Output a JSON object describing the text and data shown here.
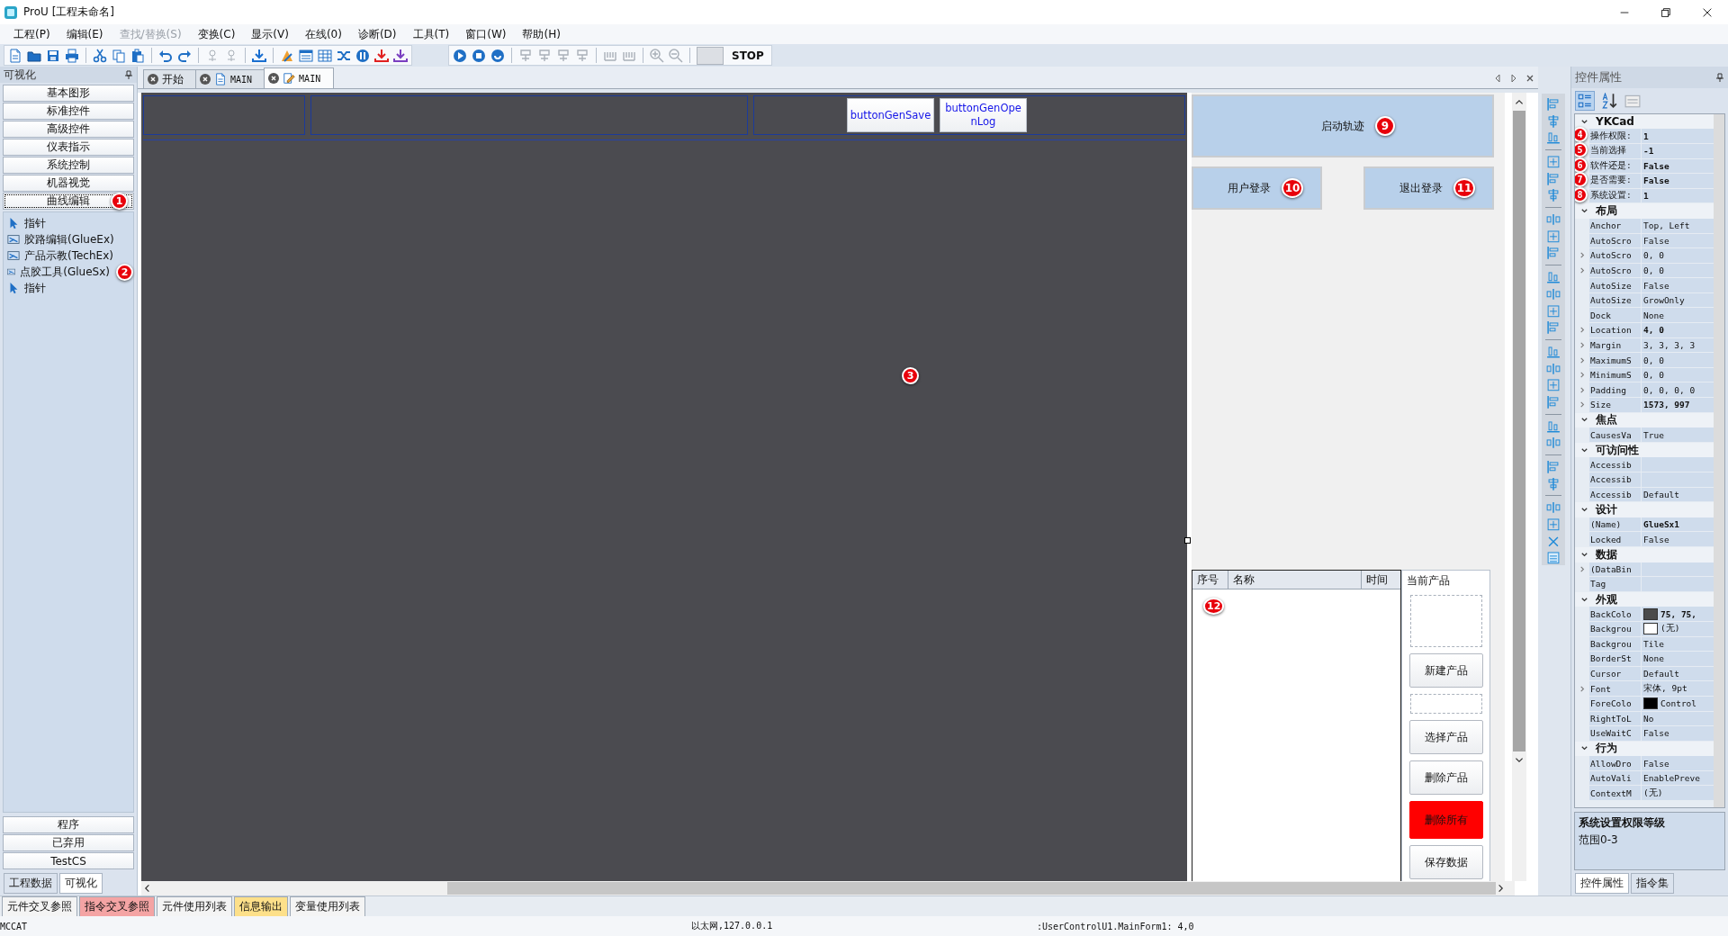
{
  "window": {
    "title": "ProU [工程未命名]"
  },
  "menu": [
    {
      "label": "工程(P)",
      "disabled": false
    },
    {
      "label": "编辑(E)",
      "disabled": false
    },
    {
      "label": "查找/替换(S)",
      "disabled": true
    },
    {
      "label": "变换(C)",
      "disabled": false
    },
    {
      "label": "显示(V)",
      "disabled": false
    },
    {
      "label": "在线(0)",
      "disabled": false
    },
    {
      "label": "诊断(D)",
      "disabled": false
    },
    {
      "label": "工具(T)",
      "disabled": false
    },
    {
      "label": "窗口(W)",
      "disabled": false
    },
    {
      "label": "帮助(H)",
      "disabled": false
    }
  ],
  "toolbar": {
    "groups": [
      [
        {
          "kind": "page",
          "disabled": false
        },
        {
          "kind": "folder",
          "disabled": false
        },
        {
          "kind": "disk",
          "disabled": false
        },
        {
          "kind": "printer",
          "disabled": false
        }
      ],
      [
        {
          "kind": "scissors",
          "disabled": false
        },
        {
          "kind": "copy",
          "disabled": false
        },
        {
          "kind": "clipboard",
          "disabled": false
        }
      ],
      [
        {
          "kind": "undo",
          "disabled": false
        },
        {
          "kind": "redo",
          "disabled": false
        }
      ],
      [
        {
          "kind": "plug",
          "disabled": true
        },
        {
          "kind": "plug",
          "disabled": true
        }
      ],
      [
        {
          "kind": "download",
          "disabled": false,
          "color": "#1a6fd0"
        }
      ],
      [
        {
          "kind": "tool",
          "disabled": false
        },
        {
          "kind": "window",
          "disabled": false
        },
        {
          "kind": "grid",
          "disabled": false
        },
        {
          "kind": "shuffle",
          "disabled": false
        },
        {
          "kind": "pause",
          "disabled": false
        },
        {
          "kind": "download",
          "disabled": false,
          "color": "#e02020"
        },
        {
          "kind": "download",
          "disabled": false,
          "color": "#7a3fc0"
        }
      ]
    ],
    "run_groups": [
      [
        {
          "kind": "play",
          "disabled": false
        },
        {
          "kind": "stop",
          "disabled": false
        },
        {
          "kind": "refresh",
          "disabled": false
        }
      ],
      [
        {
          "kind": "rung",
          "disabled": true
        },
        {
          "kind": "rung",
          "disabled": true
        },
        {
          "kind": "rung",
          "disabled": true
        },
        {
          "kind": "rung",
          "disabled": true
        }
      ],
      [
        {
          "kind": "ladder",
          "disabled": true
        },
        {
          "kind": "ladder",
          "disabled": true
        }
      ],
      [
        {
          "kind": "zoom-in",
          "disabled": true
        },
        {
          "kind": "zoom-out",
          "disabled": true
        }
      ]
    ],
    "stop_label": "STOP"
  },
  "left_panel": {
    "title": "可视化",
    "categories": [
      {
        "label": "基本图形",
        "selected": false
      },
      {
        "label": "标准控件",
        "selected": false
      },
      {
        "label": "高级控件",
        "selected": false
      },
      {
        "label": "仪表指示",
        "selected": false
      },
      {
        "label": "系统控制",
        "selected": false
      },
      {
        "label": "机器视觉",
        "selected": false
      },
      {
        "label": "曲线编辑",
        "selected": true,
        "badge": "1"
      }
    ],
    "tools": [
      {
        "label": "指针",
        "kind": "pointer"
      },
      {
        "label": "胶路编辑(GlueEx)",
        "kind": "control"
      },
      {
        "label": "产品示教(TechEx)",
        "kind": "control"
      },
      {
        "label": "点胶工具(GlueSx)",
        "kind": "control",
        "badge": "2"
      },
      {
        "label": "指针",
        "kind": "pointer"
      }
    ],
    "bottom_categories": [
      {
        "label": "程序",
        "selected": false
      },
      {
        "label": "已弃用",
        "selected": false
      },
      {
        "label": "TestCS",
        "selected": false
      }
    ],
    "tabs": [
      {
        "label": "工程数据",
        "selected": false
      },
      {
        "label": "可视化",
        "selected": true
      }
    ]
  },
  "doc_tabs": [
    {
      "label": "开始",
      "kind": "plain",
      "selected": false
    },
    {
      "label": "MAIN",
      "kind": "page",
      "selected": false
    },
    {
      "label": "MAIN",
      "kind": "edit",
      "selected": true
    }
  ],
  "canvas": {
    "badge": "3",
    "buttons": [
      "buttonGenSave",
      "buttonGenOpenLog"
    ]
  },
  "form": {
    "start_button": {
      "label": "启动轨迹",
      "badge": "9"
    },
    "login_button": {
      "label": "用户登录",
      "badge": "10"
    },
    "logout_button": {
      "label": "退出登录",
      "badge": "11"
    },
    "table": {
      "columns": [
        "序号",
        "名称",
        "时间"
      ],
      "badge": "12"
    },
    "product": {
      "title": "当前产品",
      "buttons": [
        {
          "label": "新建产品",
          "kind": "normal"
        },
        {
          "label": "选择产品",
          "kind": "normal"
        },
        {
          "label": "删除产品",
          "kind": "normal"
        },
        {
          "label": "删除所有",
          "kind": "danger"
        },
        {
          "label": "保存数据",
          "kind": "normal"
        }
      ]
    }
  },
  "properties": {
    "title": "控件属性",
    "tools": [
      {
        "kind": "categorized",
        "selected": true,
        "disabled": false
      },
      {
        "kind": "alphabetical",
        "selected": false,
        "disabled": false
      },
      {
        "kind": "pages",
        "selected": false,
        "disabled": true
      }
    ],
    "groups": [
      {
        "name": "YKCad",
        "expanded": true,
        "rows": [
          {
            "name": "操作权限:",
            "value": "1",
            "bold": true,
            "expandable": false,
            "badge": "4"
          },
          {
            "name": "当前选择",
            "value": "-1",
            "bold": true,
            "expandable": false,
            "badge": "5"
          },
          {
            "name": "软件还是:",
            "value": "False",
            "bold": true,
            "expandable": false,
            "badge": "6"
          },
          {
            "name": "是否需要:",
            "value": "False",
            "bold": true,
            "expandable": false,
            "badge": "7"
          },
          {
            "name": "系统设置:",
            "value": "1",
            "bold": true,
            "expandable": false,
            "badge": "8"
          }
        ]
      },
      {
        "name": "布局",
        "expanded": true,
        "rows": [
          {
            "name": "Anchor",
            "value": "Top, Left",
            "bold": false,
            "expandable": false
          },
          {
            "name": "AutoScro",
            "value": "False",
            "bold": false,
            "expandable": false
          },
          {
            "name": "AutoScro",
            "value": "0, 0",
            "bold": false,
            "expandable": true
          },
          {
            "name": "AutoScro",
            "value": "0, 0",
            "bold": false,
            "expandable": true
          },
          {
            "name": "AutoSize",
            "value": "False",
            "bold": false,
            "expandable": false
          },
          {
            "name": "AutoSize",
            "value": "GrowOnly",
            "bold": false,
            "expandable": false
          },
          {
            "name": "Dock",
            "value": "None",
            "bold": false,
            "expandable": false
          },
          {
            "name": "Location",
            "value": "4, 0",
            "bold": true,
            "expandable": true
          },
          {
            "name": "Margin",
            "value": "3, 3, 3, 3",
            "bold": false,
            "expandable": true
          },
          {
            "name": "MaximumS",
            "value": "0, 0",
            "bold": false,
            "expandable": true
          },
          {
            "name": "MinimumS",
            "value": "0, 0",
            "bold": false,
            "expandable": true
          },
          {
            "name": "Padding",
            "value": "0, 0, 0, 0",
            "bold": false,
            "expandable": true
          },
          {
            "name": "Size",
            "value": "1573, 997",
            "bold": true,
            "expandable": true
          }
        ]
      },
      {
        "name": "焦点",
        "expanded": true,
        "rows": [
          {
            "name": "CausesVa",
            "value": "True",
            "bold": false,
            "expandable": false
          }
        ]
      },
      {
        "name": "可访问性",
        "expanded": true,
        "rows": [
          {
            "name": "Accessib",
            "expandable": false
          },
          {
            "name": "Accessib",
            "expandable": false
          },
          {
            "name": "Accessib",
            "value": "Default",
            "bold": false,
            "expandable": false
          }
        ]
      },
      {
        "name": "设计",
        "expanded": true,
        "rows": [
          {
            "name": "(Name)",
            "value": "GlueSx1",
            "bold": true,
            "expandable": false
          },
          {
            "name": "Locked",
            "value": "False",
            "bold": false,
            "expandable": false
          }
        ]
      },
      {
        "name": "数据",
        "expanded": true,
        "rows": [
          {
            "name": "(DataBin",
            "expandable": true
          },
          {
            "name": "Tag",
            "expandable": false
          }
        ]
      },
      {
        "name": "外观",
        "expanded": true,
        "rows": [
          {
            "name": "BackColo",
            "value": "75, 75,",
            "bold": true,
            "expandable": false,
            "color": "#4b4b4b"
          },
          {
            "name": "Backgrou",
            "value": "(无)",
            "bold": false,
            "expandable": false,
            "color": "#ffffff"
          },
          {
            "name": "Backgrou",
            "value": "Tile",
            "bold": false,
            "expandable": false
          },
          {
            "name": "BorderSt",
            "value": "None",
            "bold": false,
            "expandable": false
          },
          {
            "name": "Cursor",
            "value": "Default",
            "bold": false,
            "expandable": false
          },
          {
            "name": "Font",
            "value": "宋体, 9pt",
            "bold": false,
            "expandable": true
          },
          {
            "name": "ForeColo",
            "value": "Control",
            "bold": false,
            "expandable": false,
            "color": "#000000"
          },
          {
            "name": "RightToL",
            "value": "No",
            "bold": false,
            "expandable": false
          },
          {
            "name": "UseWaitC",
            "value": "False",
            "bold": false,
            "expandable": false
          }
        ]
      },
      {
        "name": "行为",
        "expanded": true,
        "rows": [
          {
            "name": "AllowDro",
            "value": "False",
            "bold": false,
            "expandable": false
          },
          {
            "name": "AutoVali",
            "value": "EnablePreve",
            "bold": false,
            "expandable": false
          },
          {
            "name": "ContextM",
            "value": "(无)",
            "bold": false,
            "expandable": false
          }
        ]
      }
    ],
    "description": {
      "title": "系统设置权限等级",
      "text": "范围0-3"
    },
    "tabs": [
      {
        "label": "控件属性",
        "selected": true
      },
      {
        "label": "指令集",
        "selected": false
      }
    ]
  },
  "output_tabs": [
    {
      "label": "元件交叉参照",
      "color": "#f4f4f4"
    },
    {
      "label": "指令交叉参照",
      "color": "#f4a4a4"
    },
    {
      "label": "元件使用列表",
      "color": "#f4f4f4"
    },
    {
      "label": "信息输出",
      "color": "#fde08a"
    },
    {
      "label": "变量使用列表",
      "color": "#f4f4f4"
    }
  ],
  "status_bar": {
    "left": "MCCAT",
    "center": "以太网,127.0.0.1",
    "right": ":UserControlU1.MainForm1: 4,0"
  }
}
